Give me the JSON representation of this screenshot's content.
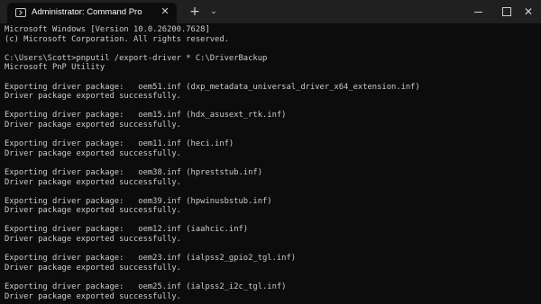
{
  "window": {
    "tab_title": "Administrator: Command Pro",
    "close_glyph": "✕",
    "new_tab_glyph": "+",
    "dropdown_glyph": "⌄",
    "close_window_glyph": "✕"
  },
  "icons": {
    "tab_icon": "terminal-icon",
    "close": "close-icon",
    "new_tab": "plus-icon",
    "dropdown": "chevron-down-icon",
    "minimize": "minimize-icon",
    "maximize": "maximize-icon",
    "close_window": "close-icon"
  },
  "colors": {
    "background": "#0c0c0c",
    "titlebar": "#202020",
    "text": "#cccccc"
  },
  "console": {
    "lines": [
      "Microsoft Windows [Version 10.0.26200.7628]",
      "(c) Microsoft Corporation. All rights reserved.",
      "",
      "C:\\Users\\Scott>pnputil /export-driver * C:\\DriverBackup",
      "Microsoft PnP Utility",
      "",
      "Exporting driver package:   oem51.inf (dxp_metadata_universal_driver_x64_extension.inf)",
      "Driver package exported successfully.",
      "",
      "Exporting driver package:   oem15.inf (hdx_asusext_rtk.inf)",
      "Driver package exported successfully.",
      "",
      "Exporting driver package:   oem11.inf (heci.inf)",
      "Driver package exported successfully.",
      "",
      "Exporting driver package:   oem38.inf (hpreststub.inf)",
      "Driver package exported successfully.",
      "",
      "Exporting driver package:   oem39.inf (hpwinusbstub.inf)",
      "Driver package exported successfully.",
      "",
      "Exporting driver package:   oem12.inf (iaahcic.inf)",
      "Driver package exported successfully.",
      "",
      "Exporting driver package:   oem23.inf (ialpss2_gpio2_tgl.inf)",
      "Driver package exported successfully.",
      "",
      "Exporting driver package:   oem25.inf (ialpss2_i2c_tgl.inf)",
      "Driver package exported successfully."
    ]
  }
}
